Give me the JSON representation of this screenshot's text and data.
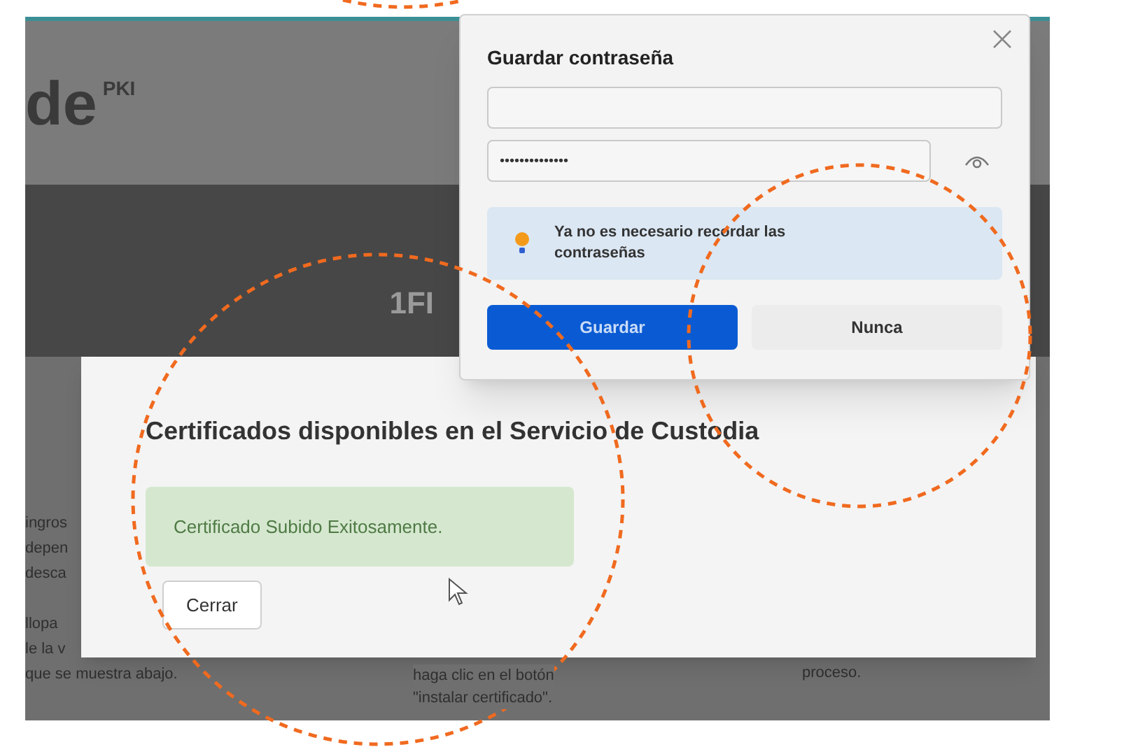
{
  "background": {
    "logo": "de",
    "logo_sup": "PKI",
    "banner_text": "1FI",
    "column_1": [
      [
        "ingros",
        "depen",
        "desca"
      ],
      [
        "llopa",
        "le la v",
        "que se muestra abajo."
      ]
    ],
    "column_2": [
      "haga clic en el botón",
      "\"instalar certificado\"."
    ],
    "column_3": [
      "proceso."
    ]
  },
  "modal": {
    "title": "Certificados disponibles en el Servicio de Custodia",
    "alert": "Certificado Subido Exitosamente.",
    "close_button": "Cerrar"
  },
  "password_popup": {
    "title": "Guardar contraseña",
    "password_value": "••••••••••••••",
    "tip": "Ya no es necesario recordar las contraseñas",
    "buttons": [
      {
        "label": "Guardar",
        "kind": "primary"
      },
      {
        "label": "Nunca",
        "kind": "secondary"
      }
    ]
  }
}
